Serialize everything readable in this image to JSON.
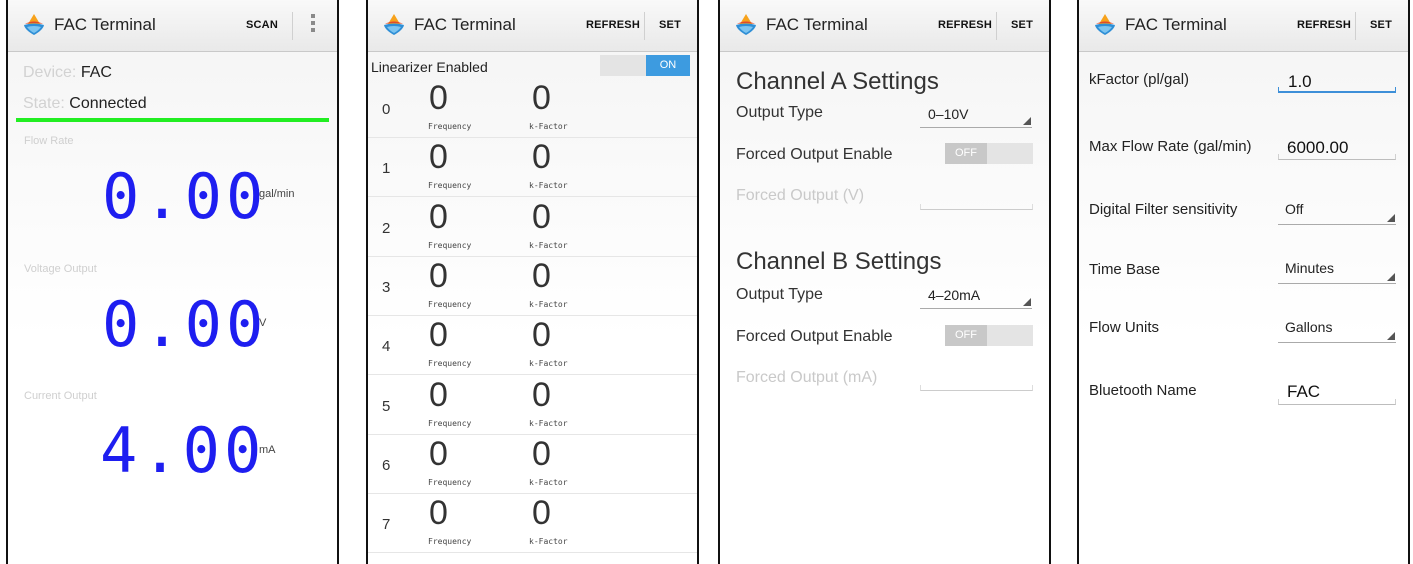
{
  "app_title": "FAC Terminal",
  "colors": {
    "accent_blue": "#1e1ef0",
    "status_green": "#22ee22",
    "toggle_on": "#3d9be0",
    "toggle_off": "#c8c8c8"
  },
  "screen1": {
    "scan_label": "SCAN",
    "device_label": "Device:",
    "device_value": "FAC",
    "state_label": "State:",
    "state_value": "Connected",
    "flow_rate_label": "Flow Rate",
    "flow_rate_value": "0.00",
    "flow_rate_unit": "gal/min",
    "voltage_label": "Voltage Output",
    "voltage_value": "0.00",
    "voltage_unit": "V",
    "current_label": "Current Output",
    "current_value": "4.00",
    "current_unit": "mA"
  },
  "screen2": {
    "refresh_label": "REFRESH",
    "set_label": "SET",
    "linearizer_label": "Linearizer Enabled",
    "linearizer_toggle": "ON",
    "freq_caption": "Frequency",
    "kf_caption": "k-Factor",
    "rows": [
      {
        "index": "0",
        "frequency": "0",
        "kfactor": "0"
      },
      {
        "index": "1",
        "frequency": "0",
        "kfactor": "0"
      },
      {
        "index": "2",
        "frequency": "0",
        "kfactor": "0"
      },
      {
        "index": "3",
        "frequency": "0",
        "kfactor": "0"
      },
      {
        "index": "4",
        "frequency": "0",
        "kfactor": "0"
      },
      {
        "index": "5",
        "frequency": "0",
        "kfactor": "0"
      },
      {
        "index": "6",
        "frequency": "0",
        "kfactor": "0"
      },
      {
        "index": "7",
        "frequency": "0",
        "kfactor": "0"
      }
    ]
  },
  "screen3": {
    "refresh_label": "REFRESH",
    "set_label": "SET",
    "channel_a": {
      "title": "Channel A Settings",
      "output_type_label": "Output Type",
      "output_type_value": "0–10V",
      "forced_enable_label": "Forced Output Enable",
      "forced_enable_toggle": "OFF",
      "forced_output_label": "Forced Output (V)"
    },
    "channel_b": {
      "title": "Channel B Settings",
      "output_type_label": "Output Type",
      "output_type_value": "4–20mA",
      "forced_enable_label": "Forced Output Enable",
      "forced_enable_toggle": "OFF",
      "forced_output_label": "Forced Output (mA)"
    }
  },
  "screen4": {
    "refresh_label": "REFRESH",
    "set_label": "SET",
    "kfactor_label": "kFactor (pl/gal)",
    "kfactor_value": "1.0",
    "max_flow_label": "Max Flow Rate (gal/min)",
    "max_flow_value": "6000.00",
    "filter_label": "Digital Filter sensitivity",
    "filter_value": "Off",
    "time_base_label": "Time Base",
    "time_base_value": "Minutes",
    "flow_units_label": "Flow Units",
    "flow_units_value": "Gallons",
    "bt_name_label": "Bluetooth Name",
    "bt_name_value": "FAC"
  }
}
